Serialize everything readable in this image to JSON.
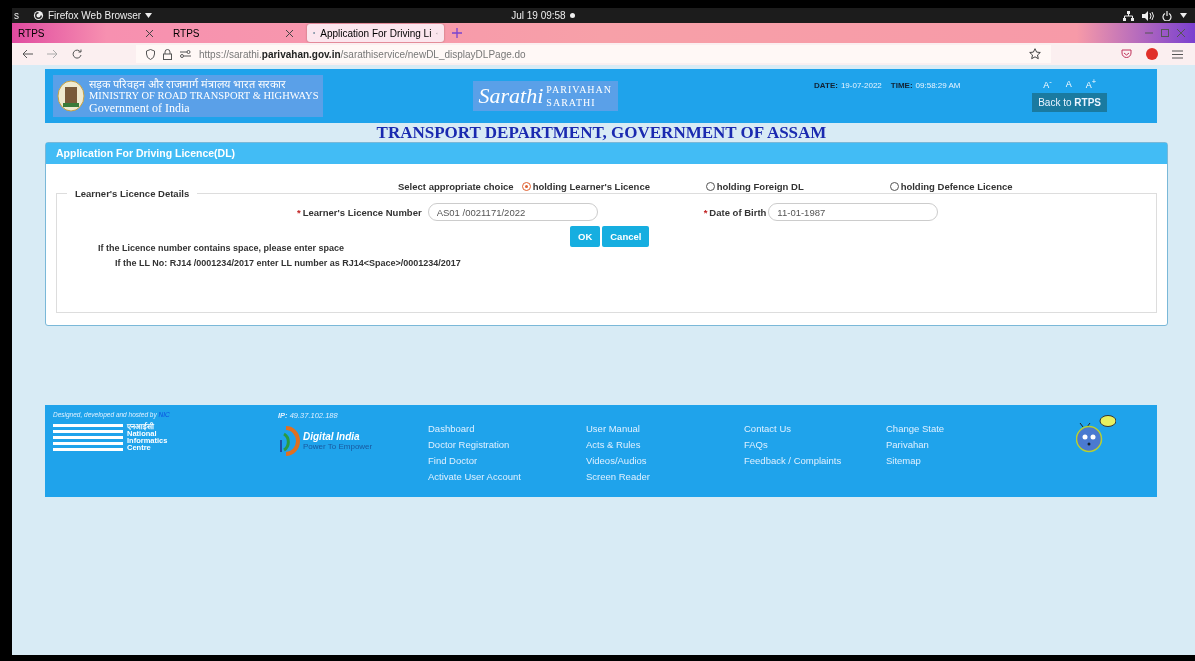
{
  "topbar": {
    "activities": "s",
    "app": "Firefox Web Browser",
    "clock": "Jul 19  09:58"
  },
  "tabs": [
    {
      "label": "RTPS",
      "selected": false
    },
    {
      "label": "RTPS",
      "selected": false
    },
    {
      "label": "Application For Driving Li",
      "selected": true
    }
  ],
  "url": "https://sarathi.**parivahan.gov.in**/sarathiservice/newDL_displayDLPage.do",
  "header": {
    "hindi": "सड़क परिवहन और राजमार्ग मंत्रालय भारत सरकार",
    "ministry": "MINISTRY OF ROAD TRANSPORT & HIGHWAYS",
    "govt": "Government of India",
    "logo_script": "Sarathi",
    "logo_line1": "PARIVAHAN",
    "logo_line2": "SARATHI",
    "date_label": "DATE:",
    "date": "19-07-2022",
    "time_label": "TIME:",
    "time": "09:58:29 AM",
    "font_sizes": [
      "A$^{-}$",
      "A",
      "A$^{+}$"
    ],
    "back_button": "Back to **RTPS**"
  },
  "department": "TRANSPORT DEPARTMENT, GOVERNMENT OF ASSAM",
  "panel": {
    "title": "Application For Driving Licence(DL)",
    "choice_label": "Select appropriate choice",
    "choices": [
      {
        "label": "holding Learner's Licence",
        "selected": true
      },
      {
        "label": "holding Foreign DL",
        "selected": false
      },
      {
        "label": "holding Defence Licence",
        "selected": false
      }
    ],
    "legend": "Learner's Licence Details",
    "fields": [
      {
        "label": "Learner's Licence Number",
        "value": "AS01 /0021171/2022",
        "required_mark": "*"
      },
      {
        "label": "Date of Birth",
        "value": "11-01-1987",
        "required_mark": "*"
      }
    ],
    "buttons": [
      "OK",
      "Cancel"
    ],
    "notes": [
      "If the Licence number contains space, please enter space",
      "If the LL No: RJ14 /0001234/2017 enter LL number as RJ14<Space>/0001234/2017"
    ]
  },
  "footer": {
    "designed": "Designed, developed and hosted by",
    "designed_by": "NIC",
    "nic_hindi": "एनआईसी",
    "nic_name": [
      "National",
      "Informatics",
      "Centre"
    ],
    "ip_label": "IP:",
    "ip": "49.37.102.188",
    "digital_india": "Digital India",
    "digital_india_tag": "Power To Empower",
    "link_columns": [
      [
        "Dashboard",
        "Doctor Registration",
        "Find Doctor",
        "Activate User Account"
      ],
      [
        "User Manual",
        "Acts & Rules",
        "Videos/Audios",
        "Screen Reader"
      ],
      [
        "Contact Us",
        "FAQs",
        "Feedback / Complaints"
      ],
      [
        "Change State",
        "Parivahan",
        "Sitemap"
      ]
    ]
  }
}
